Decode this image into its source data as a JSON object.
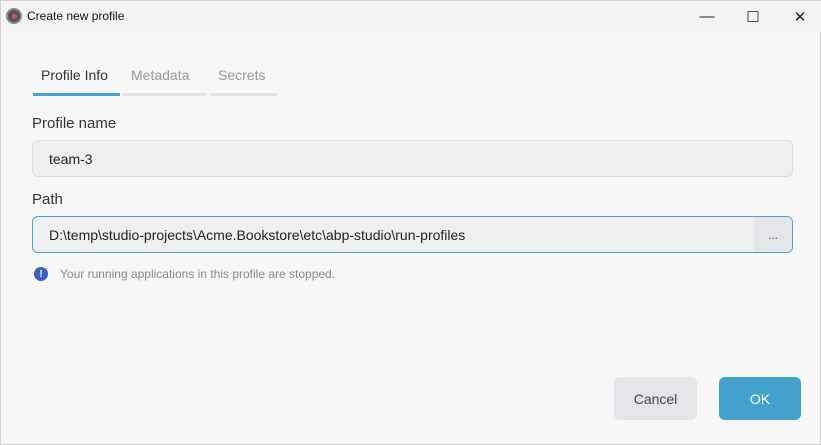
{
  "window": {
    "title": "Create new profile",
    "minimize": "—",
    "maximize": "☐",
    "close": "✕"
  },
  "tabs": [
    "Profile Info",
    "Metadata",
    "Secrets"
  ],
  "form": {
    "name_label": "Profile name",
    "name_value": "team-3",
    "path_label": "Path",
    "path_value": "D:\\temp\\studio-projects\\Acme.Bookstore\\etc\\abp-studio\\run-profiles",
    "browse": "...",
    "info": "Your running applications in this profile are stopped.",
    "info_icon": "!"
  },
  "buttons": {
    "cancel": "Cancel",
    "ok": "OK"
  },
  "colors": {
    "accent": "#42a2cc",
    "info": "#3a5fc8"
  }
}
